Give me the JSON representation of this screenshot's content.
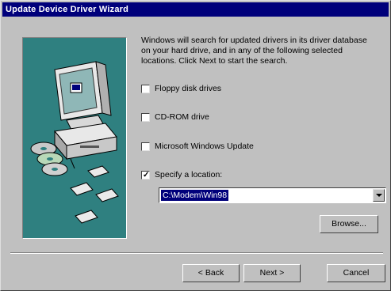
{
  "window": {
    "title": "Update Device Driver Wizard"
  },
  "intro_text": "Windows will search for updated drivers in its driver database on your hard drive, and in any of the following selected locations. Click Next to start the search.",
  "options": [
    {
      "label": "Floppy disk drives",
      "checked": false
    },
    {
      "label": "CD-ROM drive",
      "checked": false
    },
    {
      "label": "Microsoft Windows Update",
      "checked": false
    },
    {
      "label": "Specify a location:",
      "checked": true
    }
  ],
  "location": {
    "value": "C:\\Modem\\Win98"
  },
  "buttons": {
    "browse": "Browse...",
    "back": "< Back",
    "next": "Next >",
    "cancel": "Cancel"
  },
  "check_glyph": "✓"
}
